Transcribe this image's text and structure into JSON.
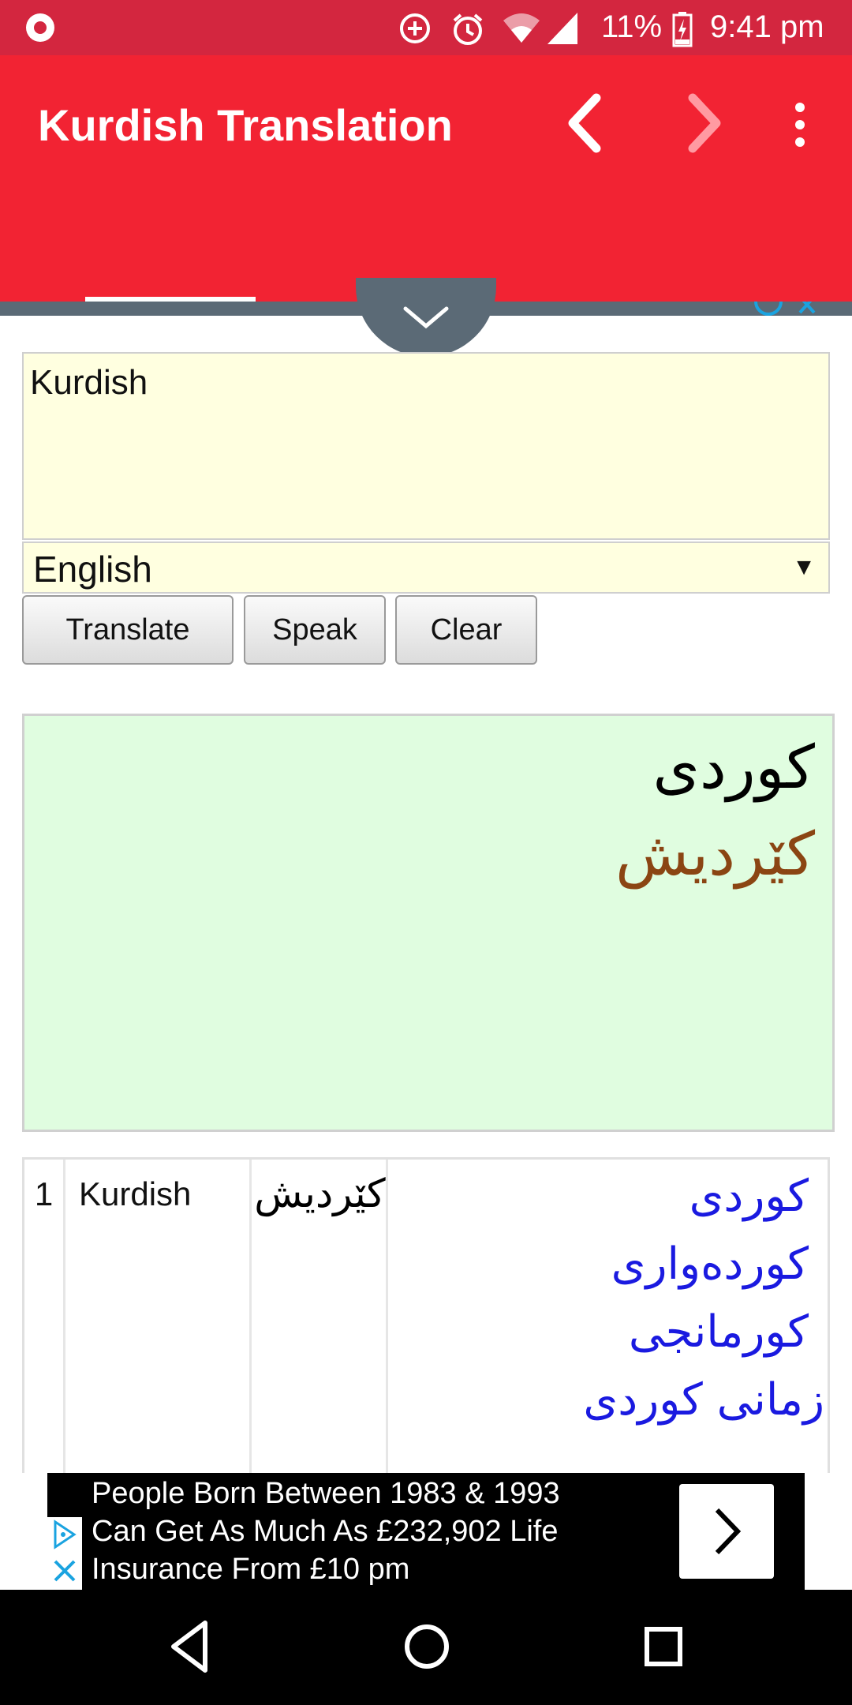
{
  "status_bar": {
    "battery_percent": "11%",
    "time": "9:41 pm",
    "icons": [
      "recording-icon",
      "data-saver-icon",
      "alarm-icon",
      "wifi-icon",
      "signal-icon",
      "battery-charging-icon"
    ]
  },
  "app_bar": {
    "title": "Kurdish Translation",
    "icons": [
      "back-arrow-icon",
      "forward-arrow-icon",
      "more-vert-icon"
    ]
  },
  "input": {
    "text": "Kurdish"
  },
  "language_select": {
    "selected": "English"
  },
  "buttons": {
    "translate": "Translate",
    "speak": "Speak",
    "clear": "Clear"
  },
  "result": {
    "line1": "کوردی",
    "line2": "کێردیش"
  },
  "table": {
    "rows": [
      {
        "number": "1",
        "word": "Kurdish",
        "transliteration": "کێردیش",
        "translations": [
          "کوردی",
          "کوردەواری",
          "کورمانجی",
          "زمانی کوردی"
        ]
      }
    ]
  },
  "ad": {
    "text_line1": "People Born Between 1983 & 1993",
    "text_line2": "Can Get As Much As £232,902 Life",
    "text_line3": "Insurance From £10 pm"
  },
  "nav_bar": {
    "icons": [
      "back-triangle-icon",
      "home-circle-icon",
      "recents-square-icon"
    ]
  }
}
